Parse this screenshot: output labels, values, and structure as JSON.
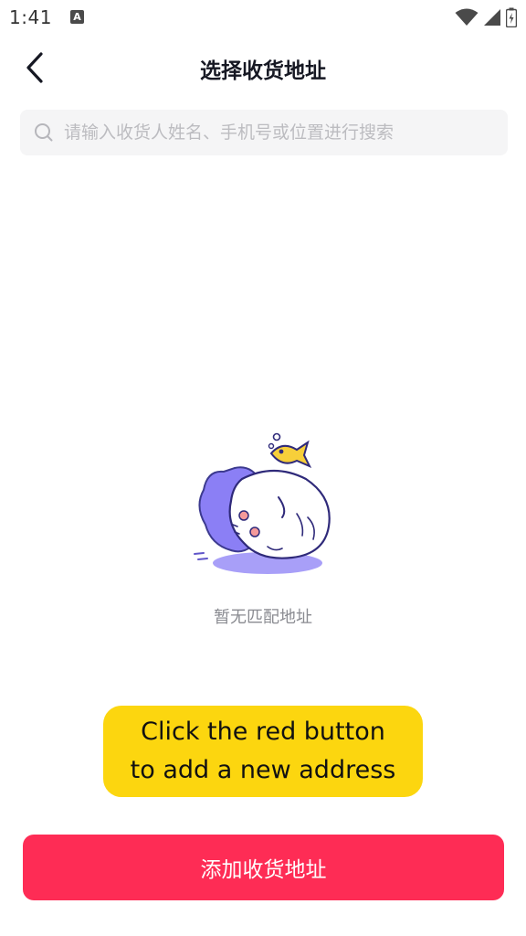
{
  "status_bar": {
    "time": "1:41",
    "notification_icon_letter": "A",
    "icons": [
      "wifi-icon",
      "cell-signal-icon",
      "battery-charging-icon"
    ]
  },
  "nav": {
    "title": "选择收货地址",
    "back_icon": "chevron-left-icon"
  },
  "search": {
    "placeholder": "请输入收货人姓名、手机号或位置进行搜索",
    "value": "",
    "icon": "search-icon"
  },
  "empty_state": {
    "illustration": "sleeping-mascot-illustration",
    "text": "暂无匹配地址"
  },
  "hint": {
    "line1": "Click the red button",
    "line2": "to add a new address"
  },
  "footer": {
    "add_button_label": "添加收货地址"
  },
  "colors": {
    "primary": "#fe2c55",
    "hint_bg": "#fcd60f",
    "search_bg": "#f5f5f6",
    "mascot_purple": "#8b7ff5",
    "fish_yellow": "#f7cf3a"
  }
}
